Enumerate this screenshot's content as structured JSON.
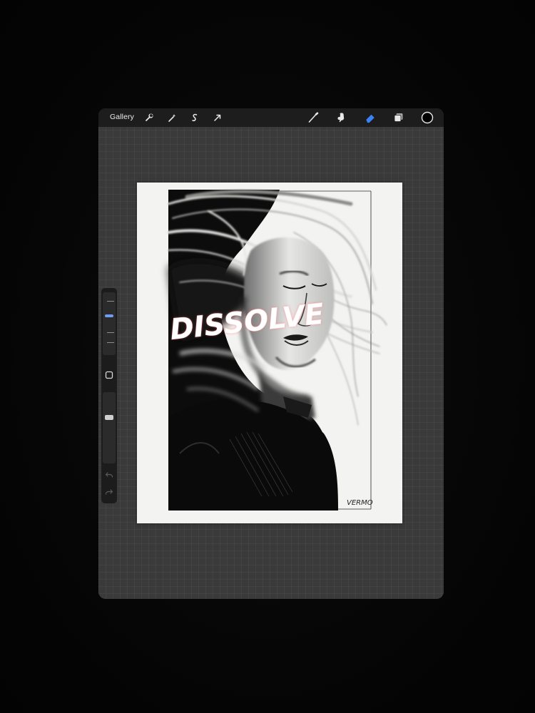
{
  "toolbar": {
    "gallery_label": "Gallery",
    "left_icons": [
      "wrench-icon",
      "magic-wand-icon",
      "selection-icon",
      "transform-arrow-icon"
    ],
    "right_icons": [
      "brush-icon",
      "smudge-icon",
      "eraser-icon",
      "layers-icon",
      "color-swatch-icon"
    ],
    "active_tool": "eraser",
    "accent_color": "#3b82f6",
    "active_color": "#000000"
  },
  "sidebar": {
    "brush_size_level": 0.3,
    "opacity_level": 0.33,
    "buttons": [
      "modify-square-icon",
      "undo-icon",
      "redo-icon"
    ]
  },
  "artwork": {
    "title_text": "DISSOLVE",
    "signature": "VERMO"
  }
}
